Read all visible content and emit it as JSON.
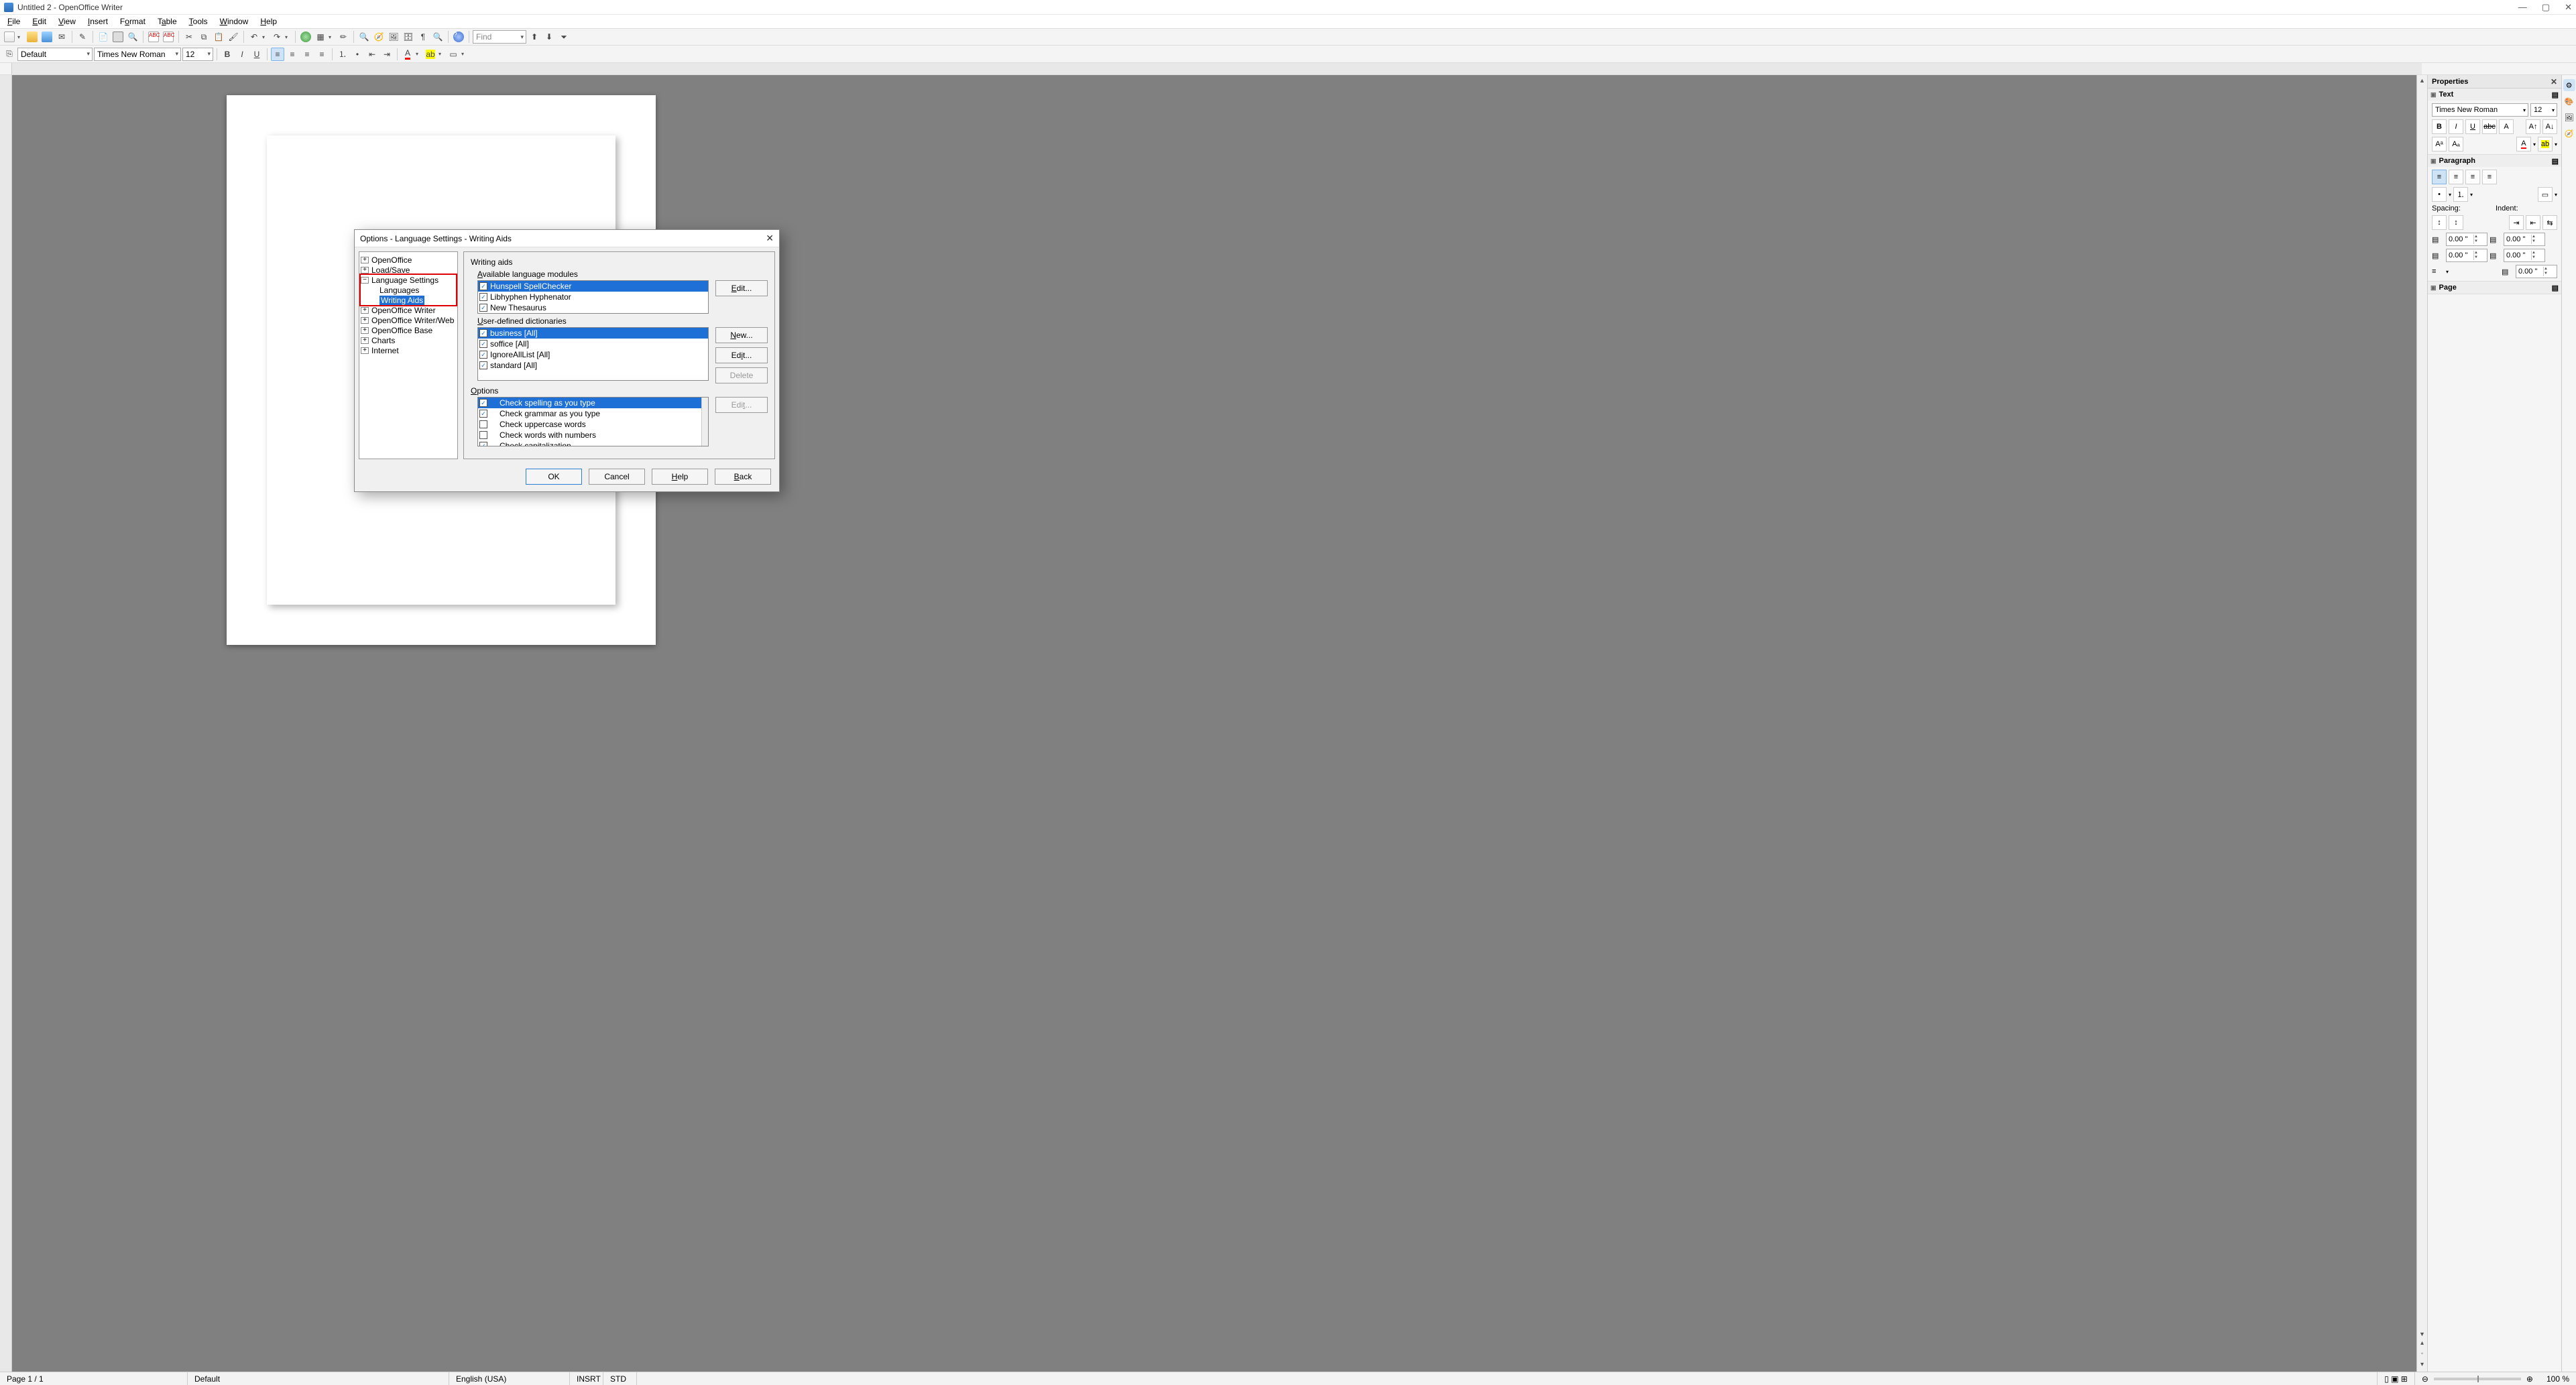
{
  "titlebar": {
    "title": "Untitled 2 - OpenOffice Writer"
  },
  "menubar": [
    "File",
    "Edit",
    "View",
    "Insert",
    "Format",
    "Table",
    "Tools",
    "Window",
    "Help"
  ],
  "toolbar": {
    "find_placeholder": "Find"
  },
  "format": {
    "style": "Default",
    "font": "Times New Roman",
    "size": "12"
  },
  "properties": {
    "title": "Properties",
    "text": {
      "label": "Text",
      "font": "Times New Roman",
      "size": "12"
    },
    "paragraph": {
      "label": "Paragraph",
      "spacing_label": "Spacing:",
      "indent_label": "Indent:",
      "above": "0.00 \"",
      "below": "0.00 \"",
      "left": "0.00 \"",
      "right": "0.00 \"",
      "first": "0.00 \""
    },
    "page": {
      "label": "Page"
    }
  },
  "statusbar": {
    "page": "Page 1 / 1",
    "style": "Default",
    "lang": "English (USA)",
    "insrt": "INSRT",
    "std": "STD",
    "zoom": "100 %"
  },
  "dialog": {
    "title": "Options - Language Settings - Writing Aids",
    "tree": [
      {
        "label": "OpenOffice",
        "expand": "+",
        "level": 0
      },
      {
        "label": "Load/Save",
        "expand": "+",
        "level": 0
      },
      {
        "label": "Language Settings",
        "expand": "−",
        "level": 0,
        "redbox": true
      },
      {
        "label": "Languages",
        "level": 1
      },
      {
        "label": "Writing Aids",
        "level": 1,
        "selected": true
      },
      {
        "label": "OpenOffice Writer",
        "expand": "+",
        "level": 0
      },
      {
        "label": "OpenOffice Writer/Web",
        "expand": "+",
        "level": 0
      },
      {
        "label": "OpenOffice Base",
        "expand": "+",
        "level": 0
      },
      {
        "label": "Charts",
        "expand": "+",
        "level": 0
      },
      {
        "label": "Internet",
        "expand": "+",
        "level": 0
      }
    ],
    "group_label": "Writing aids",
    "modules_label": "Available language modules",
    "modules": [
      {
        "label": "Hunspell SpellChecker",
        "checked": true,
        "selected": true
      },
      {
        "label": "Libhyphen Hyphenator",
        "checked": true
      },
      {
        "label": "New Thesaurus",
        "checked": true
      }
    ],
    "dicts_label": "User-defined dictionaries",
    "dicts": [
      {
        "label": "business [All]",
        "checked": true,
        "selected": true
      },
      {
        "label": "soffice [All]",
        "checked": true
      },
      {
        "label": "IgnoreAllList [All]",
        "checked": true
      },
      {
        "label": "standard [All]",
        "checked": true
      }
    ],
    "options_label": "Options",
    "options": [
      {
        "label": "Check spelling as you type",
        "checked": true,
        "selected": true
      },
      {
        "label": "Check grammar as you type",
        "checked": true
      },
      {
        "label": "Check uppercase words",
        "checked": false
      },
      {
        "label": "Check words with numbers",
        "checked": false
      },
      {
        "label": "Check capitalization",
        "checked": true
      }
    ],
    "btn_edit": "Edit...",
    "btn_new": "New...",
    "btn_delete": "Delete",
    "btn_ok": "OK",
    "btn_cancel": "Cancel",
    "btn_help": "Help",
    "btn_back": "Back"
  }
}
